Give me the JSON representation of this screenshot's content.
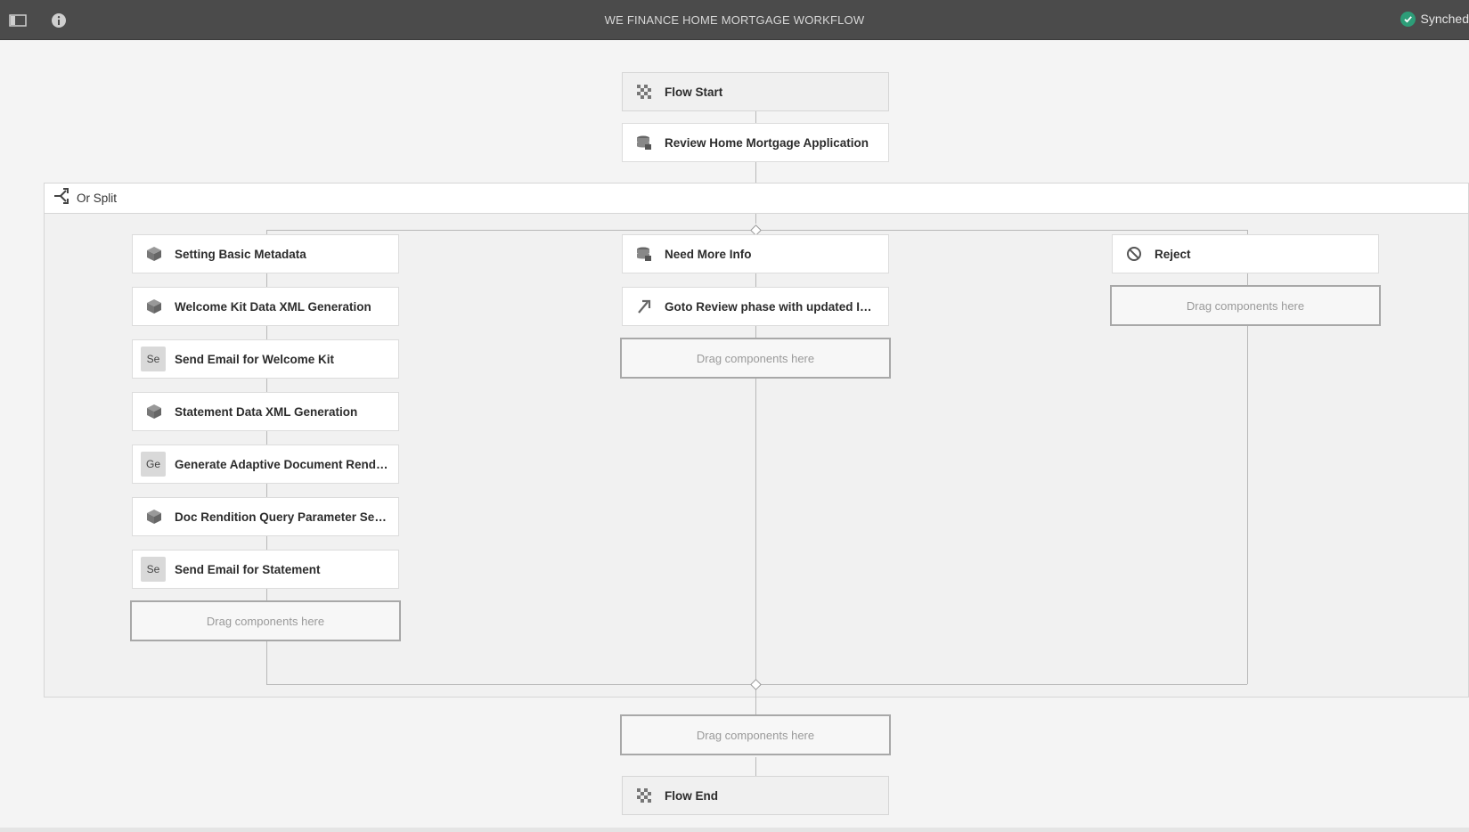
{
  "header": {
    "title": "WE FINANCE HOME MORTGAGE WORKFLOW",
    "status": "Synched",
    "left_icons": [
      "sidebar-toggle-icon",
      "info-icon"
    ]
  },
  "flow": {
    "start": "Flow Start",
    "review": "Review Home Mortgage Application",
    "end": "Flow End"
  },
  "split": {
    "label": "Or Split",
    "branch1": [
      {
        "label": "Setting Basic Metadata",
        "icon": "package-icon"
      },
      {
        "label": "Welcome Kit Data XML Generation",
        "icon": "package-icon"
      },
      {
        "label": "Send Email for Welcome Kit",
        "icon": "Se"
      },
      {
        "label": "Statement Data XML Generation",
        "icon": "package-icon"
      },
      {
        "label": "Generate Adaptive Document Renditio...",
        "icon": "Ge"
      },
      {
        "label": "Doc Rendition Query Parameter Settin...",
        "icon": "package-icon"
      },
      {
        "label": "Send Email for Statement",
        "icon": "Se"
      }
    ],
    "branch2": [
      {
        "label": "Need More Info",
        "icon": "database-icon"
      },
      {
        "label": "Goto Review phase with updated Infor...",
        "icon": "goto-arrow-icon"
      }
    ],
    "branch3": [
      {
        "label": "Reject",
        "icon": "block-icon"
      }
    ]
  },
  "drop_placeholder": "Drag components here",
  "colors": {
    "topbar": "#4b4b4b",
    "synched_check": "#2d9d78",
    "canvas": "#f4f4f4"
  }
}
